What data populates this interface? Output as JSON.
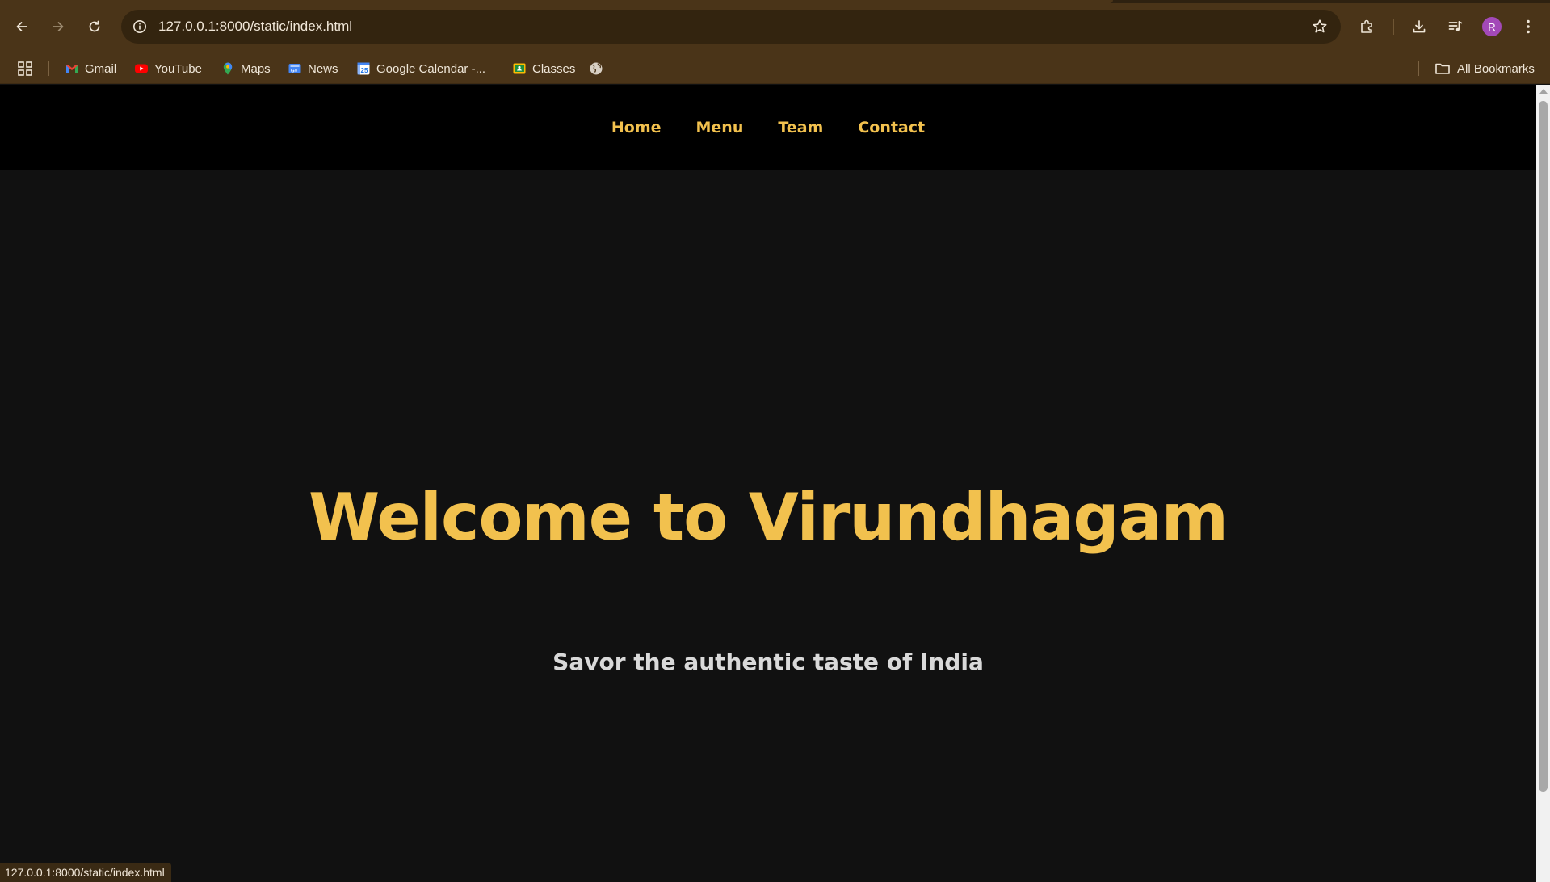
{
  "browser": {
    "url": "127.0.0.1:8000/static/index.html",
    "profile_initial": "R",
    "status_url": "127.0.0.1:8000/static/index.html",
    "bookmarks": [
      {
        "label": "Gmail",
        "icon": "gmail-icon"
      },
      {
        "label": "YouTube",
        "icon": "youtube-icon"
      },
      {
        "label": "Maps",
        "icon": "maps-icon"
      },
      {
        "label": "News",
        "icon": "news-icon"
      },
      {
        "label": "Google Calendar -...",
        "icon": "calendar-icon"
      },
      {
        "label": "Classes",
        "icon": "classroom-icon"
      }
    ],
    "all_bookmarks_label": "All Bookmarks"
  },
  "site": {
    "nav": [
      "Home",
      "Menu",
      "Team",
      "Contact"
    ],
    "hero_title": "Welcome to Virundhagam",
    "hero_subtitle": "Savor the authentic taste of India"
  },
  "colors": {
    "accent": "#f2c14e",
    "nav_bg": "#000000",
    "page_bg": "#111111",
    "browser_frame": "#4a3418"
  }
}
